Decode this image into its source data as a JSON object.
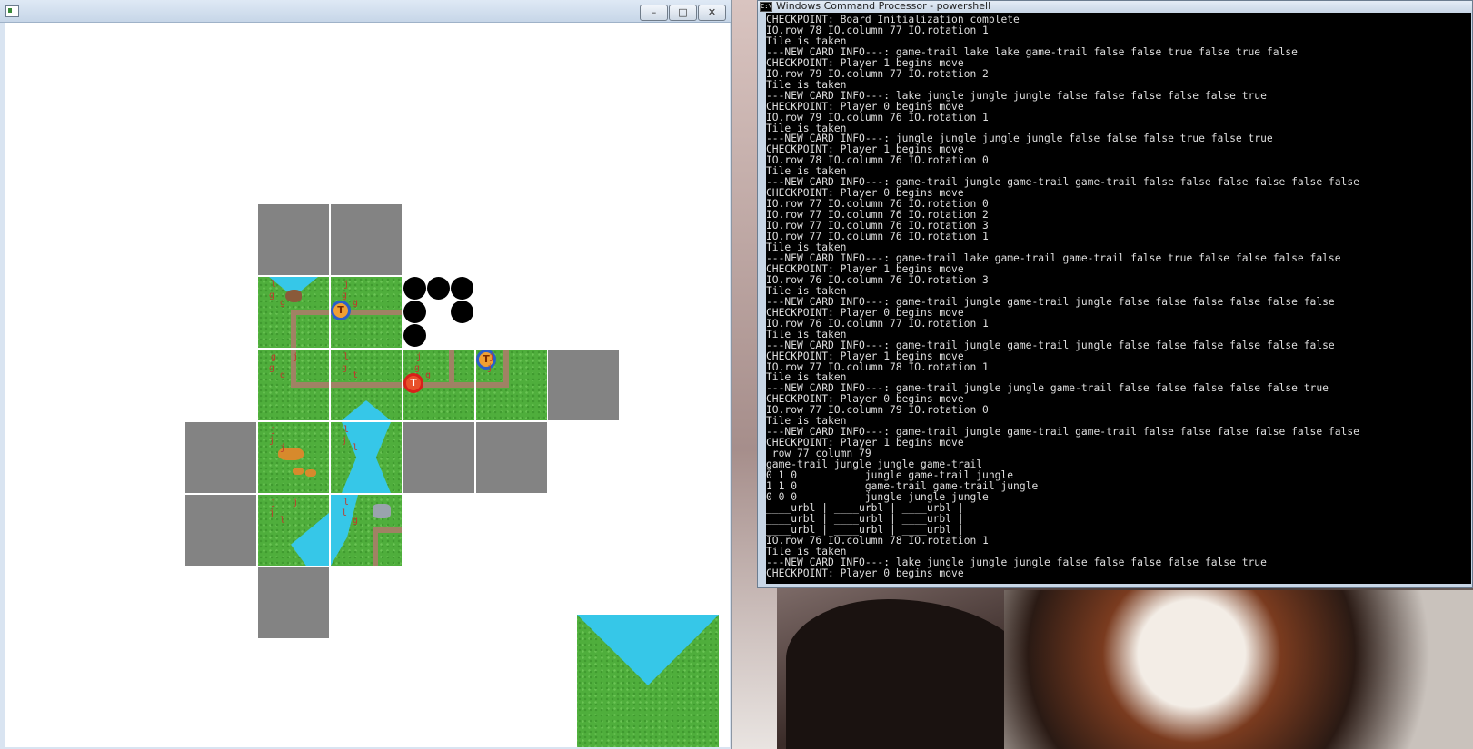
{
  "console": {
    "title": "Windows Command Processor - powershell",
    "icon_text": "C:\\",
    "lines": [
      "CHECKPOINT: Board Initialization complete",
      "IO.row 78 IO.column 77 IO.rotation 1",
      "Tile is taken",
      "---NEW CARD INFO---: game-trail lake lake game-trail false false true false true false",
      "CHECKPOINT: Player 1 begins move",
      "IO.row 79 IO.column 77 IO.rotation 2",
      "Tile is taken",
      "---NEW CARD INFO---: lake jungle jungle jungle false false false false false true",
      "CHECKPOINT: Player 0 begins move",
      "IO.row 79 IO.column 76 IO.rotation 1",
      "Tile is taken",
      "---NEW CARD INFO---: jungle jungle jungle jungle false false false true false true",
      "CHECKPOINT: Player 1 begins move",
      "IO.row 78 IO.column 76 IO.rotation 0",
      "Tile is taken",
      "---NEW CARD INFO---: game-trail jungle game-trail game-trail false false false false false false",
      "CHECKPOINT: Player 0 begins move",
      "IO.row 77 IO.column 76 IO.rotation 0",
      "IO.row 77 IO.column 76 IO.rotation 2",
      "IO.row 77 IO.column 76 IO.rotation 3",
      "IO.row 77 IO.column 76 IO.rotation 1",
      "Tile is taken",
      "---NEW CARD INFO---: game-trail lake game-trail game-trail false true false false false false",
      "CHECKPOINT: Player 1 begins move",
      "IO.row 76 IO.column 76 IO.rotation 3",
      "Tile is taken",
      "---NEW CARD INFO---: game-trail jungle game-trail jungle false false false false false false",
      "CHECKPOINT: Player 0 begins move",
      "IO.row 76 IO.column 77 IO.rotation 1",
      "Tile is taken",
      "---NEW CARD INFO---: game-trail jungle game-trail jungle false false false false false false",
      "CHECKPOINT: Player 1 begins move",
      "IO.row 77 IO.column 78 IO.rotation 1",
      "Tile is taken",
      "---NEW CARD INFO---: game-trail jungle jungle game-trail false false false false false true",
      "CHECKPOINT: Player 0 begins move",
      "IO.row 77 IO.column 79 IO.rotation 0",
      "Tile is taken",
      "---NEW CARD INFO---: game-trail jungle game-trail game-trail false false false false false false",
      "CHECKPOINT: Player 1 begins move",
      " row 77 column 79",
      "game-trail jungle jungle game-trail",
      "0 1 0           jungle game-trail jungle",
      "1 1 0           game-trail game-trail jungle",
      "0 0 0           jungle jungle jungle",
      "____urbl | ____urbl | ____urbl |",
      "____urbl | ____urbl | ____urbl |",
      "____urbl | ____urbl | ____urbl |",
      "IO.row 76 IO.column 78 IO.rotation 1",
      "Tile is taken",
      "---NEW CARD INFO---: lake jungle jungle jungle false false false false false true",
      "CHECKPOINT: Player 0 begins move"
    ]
  },
  "game_window": {
    "min_label": "–",
    "max_label": "□",
    "close_label": "✕"
  },
  "tile_marks": {
    "t_r1c2": [
      "l",
      "g",
      "g"
    ],
    "t_r1c3": [
      "j",
      "g",
      "g"
    ],
    "t_r2c2": [
      "g",
      "g",
      "g",
      "j"
    ],
    "t_r2c3": [
      "l",
      "g",
      "t"
    ],
    "t_r2c4": [
      "j",
      "g",
      "g"
    ],
    "t_r2c5": [
      "j",
      "j"
    ],
    "t_r3c2": [
      "j",
      "j",
      "j"
    ],
    "t_r3c3": [
      "l",
      "j",
      "l"
    ],
    "t_r4c2": [
      "j",
      "j",
      "l",
      "j"
    ],
    "t_r4c3": [
      "l",
      "l",
      "g"
    ]
  },
  "colors": {
    "grass": "#4fae3c",
    "lake": "#36c7e8",
    "empty_slot": "#838383",
    "trail": "#a08264",
    "player_blue": "#2a5fc8",
    "player_red": "#d8201a"
  }
}
